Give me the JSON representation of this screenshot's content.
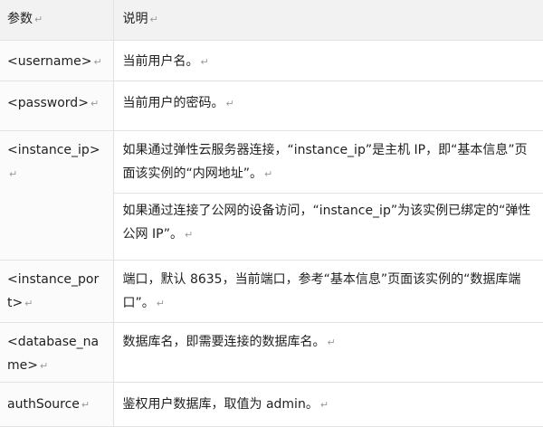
{
  "header": {
    "param": "参数",
    "desc": "说明"
  },
  "return_mark": "↵",
  "rows": [
    {
      "param": "<username>",
      "desc": [
        "当前用户名。"
      ]
    },
    {
      "param": "<password>",
      "desc": [
        "当前用户的密码。"
      ]
    },
    {
      "param": "<instance_ip>",
      "desc": [
        "如果通过弹性云服务器连接，“instance_ip”是主机 IP，即“基本信息”页面该实例的“内网地址”。",
        "如果通过连接了公网的设备访问，“instance_ip”为该实例已绑定的“弹性公网 IP”。"
      ]
    },
    {
      "param": "<instance_port>",
      "desc": [
        "端口，默认 8635，当前端口，参考“基本信息”页面该实例的“数据库端口”。"
      ]
    },
    {
      "param": "<database_name>",
      "desc": [
        "数据库名，即需要连接的数据库名。"
      ]
    },
    {
      "param": "authSource",
      "desc": [
        "鉴权用户数据库，取值为 admin。"
      ]
    }
  ]
}
